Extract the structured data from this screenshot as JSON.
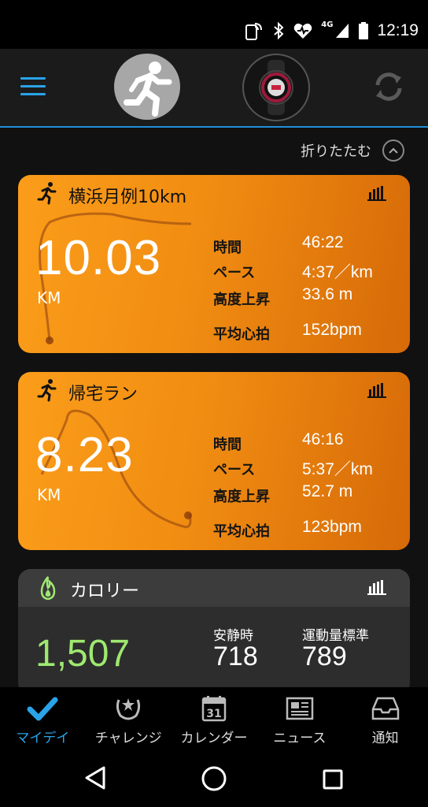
{
  "status_bar": {
    "time": "12:19",
    "network": "4G"
  },
  "header": {
    "menu_icon": "hamburger-icon",
    "avatar_icon": "runner-avatar-icon",
    "device_icon": "watch-icon",
    "sync_icon": "sync-icon",
    "accent_color": "#2aa3e8"
  },
  "collapse": {
    "label": "折りたたむ",
    "icon": "chevron-up-icon"
  },
  "activities": [
    {
      "title": "横浜月例10km",
      "distance": "10.03",
      "unit": "KM",
      "stats": [
        {
          "label": "時間",
          "value": "46:22"
        },
        {
          "label": "ペース",
          "value": "4:37／km"
        },
        {
          "label": "高度上昇",
          "value": "33.6 m"
        },
        {
          "label": "平均心拍",
          "value": "152bpm"
        }
      ]
    },
    {
      "title": "帰宅ラン",
      "distance": "8.23",
      "unit": "KM",
      "stats": [
        {
          "label": "時間",
          "value": "46:16"
        },
        {
          "label": "ペース",
          "value": "5:37／km"
        },
        {
          "label": "高度上昇",
          "value": "52.7 m"
        },
        {
          "label": "平均心拍",
          "value": "123bpm"
        }
      ]
    }
  ],
  "calorie": {
    "title": "カロリー",
    "total": "1,507",
    "resting_label": "安静時",
    "resting_value": "718",
    "active_label": "運動量標準",
    "active_value": "789",
    "accent_color": "#9fe870"
  },
  "bottom_nav": {
    "items": [
      {
        "label": "マイデイ",
        "icon": "check-icon",
        "active": true
      },
      {
        "label": "チャレンジ",
        "icon": "laurel-icon",
        "active": false
      },
      {
        "label": "カレンダー",
        "icon": "calendar-icon",
        "calendar_day": "31",
        "active": false
      },
      {
        "label": "ニュース",
        "icon": "news-icon",
        "active": false
      },
      {
        "label": "通知",
        "icon": "inbox-icon",
        "active": false
      }
    ]
  },
  "system_nav": {
    "back_icon": "back-triangle-icon",
    "home_icon": "home-circle-icon",
    "recents_icon": "recents-square-icon"
  }
}
